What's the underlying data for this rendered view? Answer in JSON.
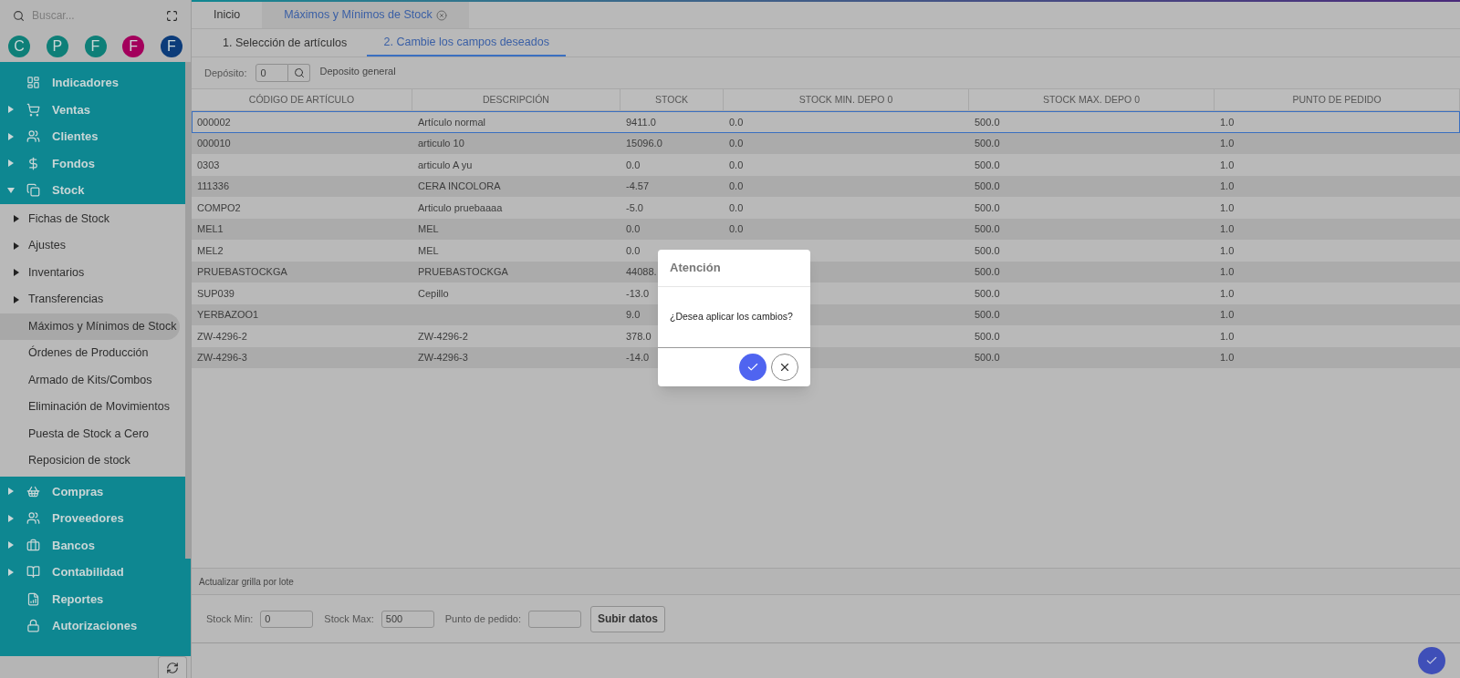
{
  "search": {
    "placeholder": "Buscar..."
  },
  "avatars": [
    {
      "letter": "C",
      "color": "#0e7f78"
    },
    {
      "letter": "P",
      "color": "#0e7f78"
    },
    {
      "letter": "F",
      "color": "#0e7f78"
    },
    {
      "letter": "F",
      "color": "#a3005c"
    },
    {
      "letter": "F",
      "color": "#0c3c7a"
    }
  ],
  "sidebar": {
    "items": [
      {
        "label": "Indicadores",
        "expandable": false
      },
      {
        "label": "Ventas",
        "expandable": true,
        "expanded": false
      },
      {
        "label": "Clientes",
        "expandable": true,
        "expanded": false
      },
      {
        "label": "Fondos",
        "expandable": true,
        "expanded": false
      },
      {
        "label": "Stock",
        "expandable": true,
        "expanded": true,
        "children": [
          {
            "label": "Fichas de Stock",
            "expandable": true,
            "selected": false
          },
          {
            "label": "Ajustes",
            "expandable": true,
            "selected": false
          },
          {
            "label": "Inventarios",
            "expandable": true,
            "selected": false
          },
          {
            "label": "Transferencias",
            "expandable": true,
            "selected": false
          },
          {
            "label": "Máximos y Mínimos de Stock",
            "expandable": false,
            "selected": true
          },
          {
            "label": "Órdenes de Producción",
            "expandable": false,
            "selected": false
          },
          {
            "label": "Armado de Kits/Combos",
            "expandable": false,
            "selected": false
          },
          {
            "label": "Eliminación de Movimientos",
            "expandable": false,
            "selected": false
          },
          {
            "label": "Puesta de Stock a Cero",
            "expandable": false,
            "selected": false
          },
          {
            "label": "Reposicion de stock",
            "expandable": false,
            "selected": false
          }
        ]
      },
      {
        "label": "Compras",
        "expandable": true,
        "expanded": false
      },
      {
        "label": "Proveedores",
        "expandable": true,
        "expanded": false
      },
      {
        "label": "Bancos",
        "expandable": true,
        "expanded": false
      },
      {
        "label": "Contabilidad",
        "expandable": true,
        "expanded": false
      },
      {
        "label": "Reportes",
        "expandable": false
      },
      {
        "label": "Autorizaciones",
        "expandable": false
      }
    ]
  },
  "tabs": [
    {
      "label": "Inicio",
      "selected": false,
      "closable": false
    },
    {
      "label": "Máximos y Mínimos de Stock",
      "selected": true,
      "closable": true
    }
  ],
  "steps": [
    {
      "label": "1. Selección de artículos",
      "selected": false
    },
    {
      "label": "2. Cambie los campos deseados",
      "selected": true
    }
  ],
  "deposit": {
    "label": "Depósito:",
    "value": "0",
    "name": "Deposito general"
  },
  "table": {
    "columns": [
      "CÓDIGO DE ARTÍCULO",
      "DESCRIPCIÓN",
      "STOCK",
      "STOCK MIN. DEPO 0",
      "STOCK MAX. DEPO 0",
      "PUNTO DE PEDIDO"
    ],
    "rows": [
      {
        "selected": true,
        "cells": [
          "000002",
          "Artículo normal",
          "9411.0",
          "0.0",
          "500.0",
          "1.0"
        ]
      },
      {
        "selected": false,
        "cells": [
          "000010",
          "articulo 10",
          "15096.0",
          "0.0",
          "500.0",
          "1.0"
        ]
      },
      {
        "selected": false,
        "cells": [
          "0303",
          "articulo A yu",
          "0.0",
          "0.0",
          "500.0",
          "1.0"
        ]
      },
      {
        "selected": false,
        "cells": [
          "111336",
          "CERA INCOLORA",
          "-4.57",
          "0.0",
          "500.0",
          "1.0"
        ]
      },
      {
        "selected": false,
        "cells": [
          "COMPO2",
          "Articulo pruebaaaa",
          "-5.0",
          "0.0",
          "500.0",
          "1.0"
        ]
      },
      {
        "selected": false,
        "cells": [
          "MEL1",
          "MEL",
          "0.0",
          "0.0",
          "500.0",
          "1.0"
        ]
      },
      {
        "selected": false,
        "cells": [
          "MEL2",
          "MEL",
          "0.0",
          null,
          "500.0",
          "1.0"
        ]
      },
      {
        "selected": false,
        "cells": [
          "PRUEBASTOCKGA",
          "PRUEBASTOCKGA",
          "44088.",
          null,
          "500.0",
          "1.0"
        ]
      },
      {
        "selected": false,
        "cells": [
          "SUP039",
          "Cepillo",
          "-13.0",
          null,
          "500.0",
          "1.0"
        ]
      },
      {
        "selected": false,
        "cells": [
          "YERBAZOO1",
          null,
          "9.0",
          null,
          "500.0",
          "1.0"
        ]
      },
      {
        "selected": false,
        "cells": [
          "ZW-4296-2",
          "ZW-4296-2",
          "378.0",
          null,
          "500.0",
          "1.0"
        ]
      },
      {
        "selected": false,
        "cells": [
          "ZW-4296-3",
          "ZW-4296-3",
          "-14.0",
          null,
          "500.0",
          "1.0"
        ]
      }
    ]
  },
  "batch": {
    "title": "Actualizar grilla por lote",
    "fields": [
      {
        "label": "Stock Min:",
        "value": "0"
      },
      {
        "label": "Stock Max:",
        "value": "500"
      },
      {
        "label": "Punto de pedido:"
      }
    ],
    "button": "Subir datos"
  },
  "dialog": {
    "title": "Atención",
    "message": "¿Desea aplicar los cambios?"
  }
}
